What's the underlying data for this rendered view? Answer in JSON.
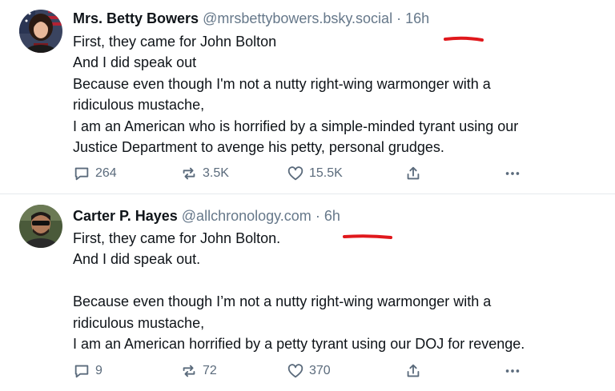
{
  "posts": [
    {
      "author": "Mrs. Betty Bowers",
      "handle": "@mrsbettybowers.bsky.social",
      "separator": "·",
      "time": "16h",
      "lines": [
        "First, they came for John Bolton",
        "And I did speak out",
        "Because even though I'm not a nutty right-wing warmonger with a",
        "ridiculous mustache,",
        "I am an American who is horrified by a simple-minded tyrant using our",
        "Justice Department to avenge his petty, personal grudges."
      ],
      "replies": "264",
      "reposts": "3.5K",
      "likes": "15.5K"
    },
    {
      "author": "Carter P. Hayes",
      "handle": "@allchronology.com",
      "separator": "·",
      "time": "6h",
      "lines": [
        "First, they came for John Bolton.",
        "And I did speak out.",
        "",
        "Because even though I’m not a nutty right-wing warmonger with a",
        "ridiculous mustache,",
        "I am an American horrified by a petty tyrant using our DOJ for revenge."
      ],
      "replies": "9",
      "reposts": "72",
      "likes": "370"
    }
  ],
  "icons": {
    "reply": "speech-bubble-icon",
    "repost": "repost-arrows-icon",
    "like": "heart-icon",
    "share": "share-icon",
    "more": "ellipsis-icon"
  },
  "colors": {
    "text": "#0f1419",
    "muted": "#66788a",
    "action": "#5b6b7c",
    "annotation_mark": "#e0181c"
  }
}
